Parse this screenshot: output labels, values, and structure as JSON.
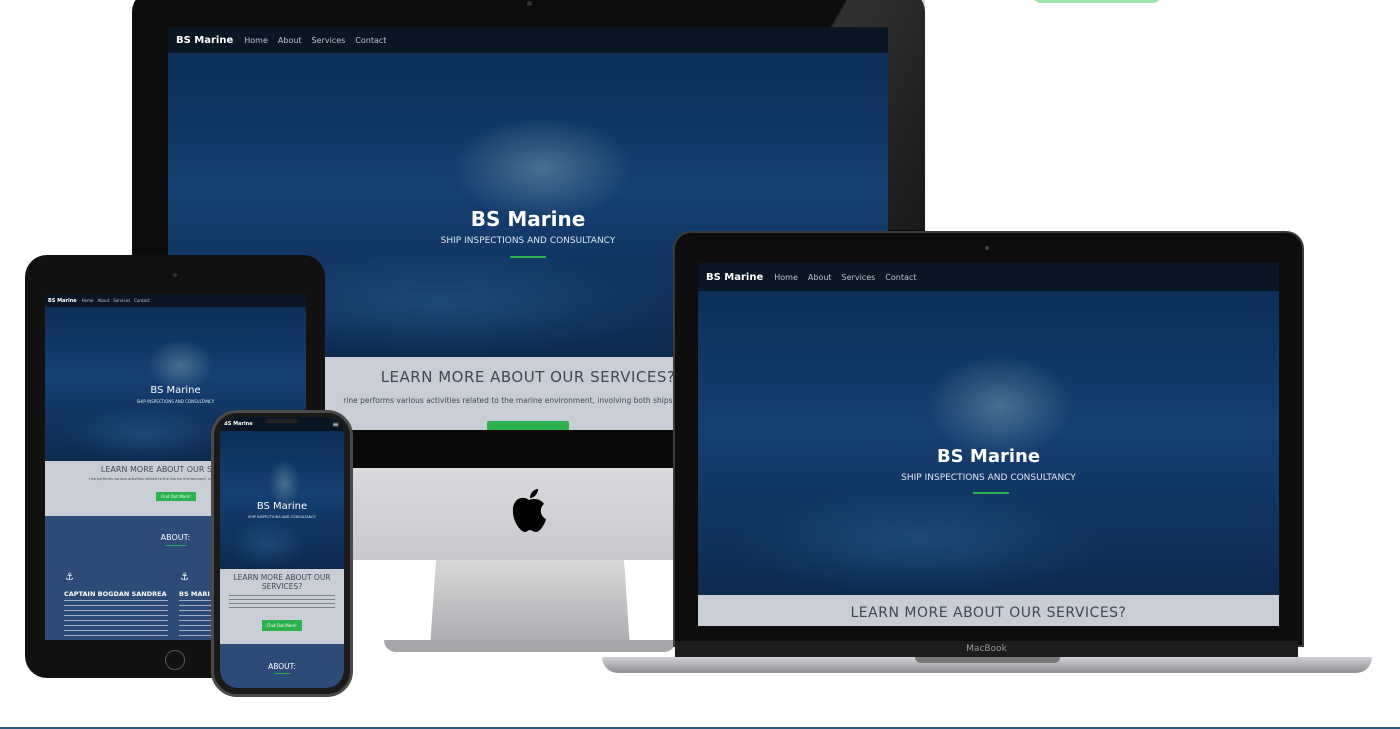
{
  "site": {
    "brand": "BS Marine",
    "nav": [
      "Home",
      "About",
      "Services",
      "Contact"
    ],
    "hero_title": "BS Marine",
    "hero_subtitle": "SHIP INSPECTIONS AND CONSULTANCY",
    "services_heading": "LEARN MORE ABOUT OUR SERVICES?",
    "services_text": "rine performs various activities related to the marine environment, involving both ships and Owne",
    "cta_button": "Find Out More!",
    "about_heading": "ABOUT:",
    "captain_heading": "CAPTAIN BOGDAN SANDREA",
    "company_heading": "BS MARI"
  },
  "laptop": {
    "label": "MacBook"
  },
  "colors": {
    "accent": "#2bb24c",
    "nav_bg": "#0b1624",
    "about_bg": "#2c4b77",
    "services_bg": "#c9ced6",
    "divider": "#2c5a7a"
  }
}
